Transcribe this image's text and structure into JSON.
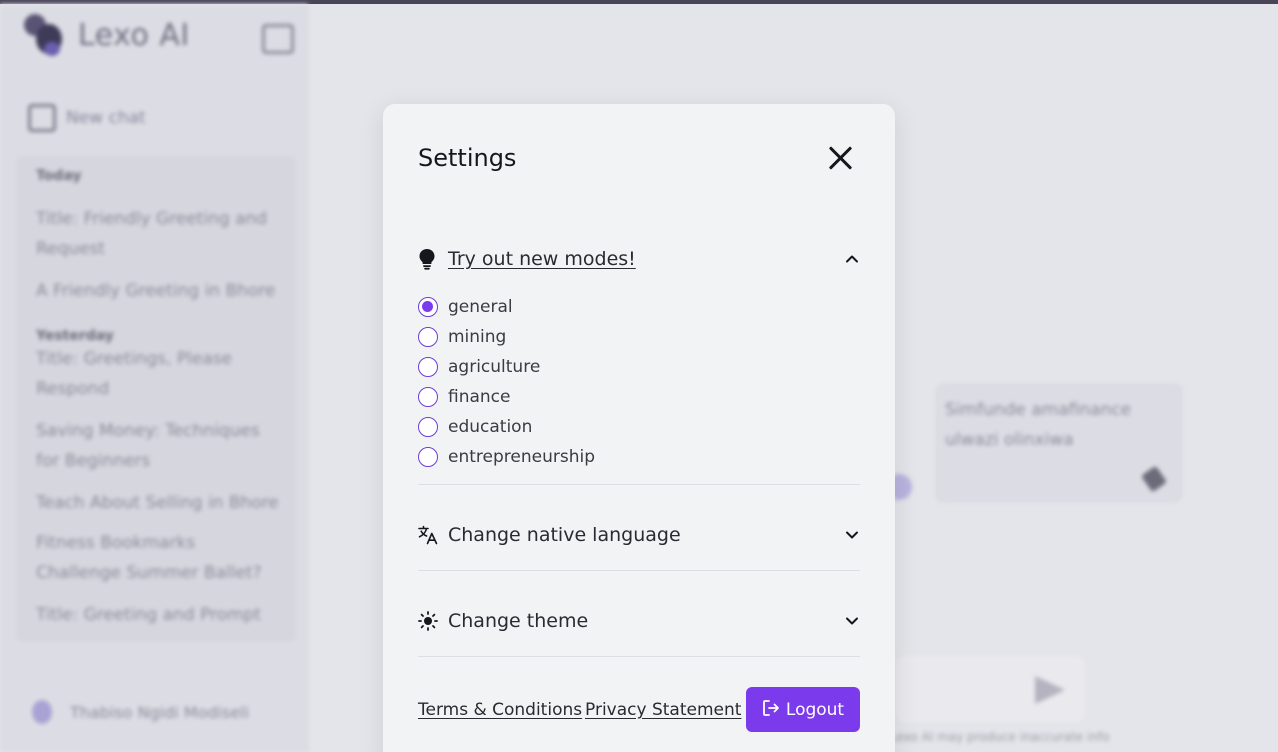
{
  "app": {
    "name": "Lexo AI",
    "new_chat_label": "New chat",
    "history": {
      "today_label": "Today",
      "today_items": [
        "Title: Friendly Greeting and Request",
        "A Friendly Greeting in Bhore"
      ],
      "yesterday_label": "Yesterday",
      "yesterday_items": [
        "Title: Greetings, Please Respond",
        "Saving Money: Techniques for Beginners",
        "Teach About Selling in Bhore",
        "Fitness Bookmarks Challenge Summer Ballet?",
        "Title: Greeting and Prompt"
      ]
    },
    "user_name": "Thabiso Ngidi Modiseli",
    "suggestion_card_text": "Simfunde amafinance ulwazi olinxiwa",
    "disclaimer": "Lexo AI may produce inaccurate info"
  },
  "settings": {
    "title": "Settings",
    "modes_section": {
      "label": "Try out new modes!",
      "icon": "lightbulb-icon",
      "expanded": true,
      "selected": "general",
      "options": [
        "general",
        "mining",
        "agriculture",
        "finance",
        "education",
        "entrepreneurship"
      ]
    },
    "language_section": {
      "label": "Change native language",
      "icon": "translate-icon",
      "expanded": false
    },
    "theme_section": {
      "label": "Change theme",
      "icon": "sun-icon",
      "expanded": false
    },
    "footer": {
      "terms_label": "Terms & Conditions",
      "privacy_label": "Privacy Statement",
      "logout_label": "Logout",
      "logout_icon": "logout-icon"
    }
  },
  "colors": {
    "accent": "#7c3aed",
    "modal_bg": "#f2f3f5",
    "overlay_bg": "#e4e5ea"
  }
}
